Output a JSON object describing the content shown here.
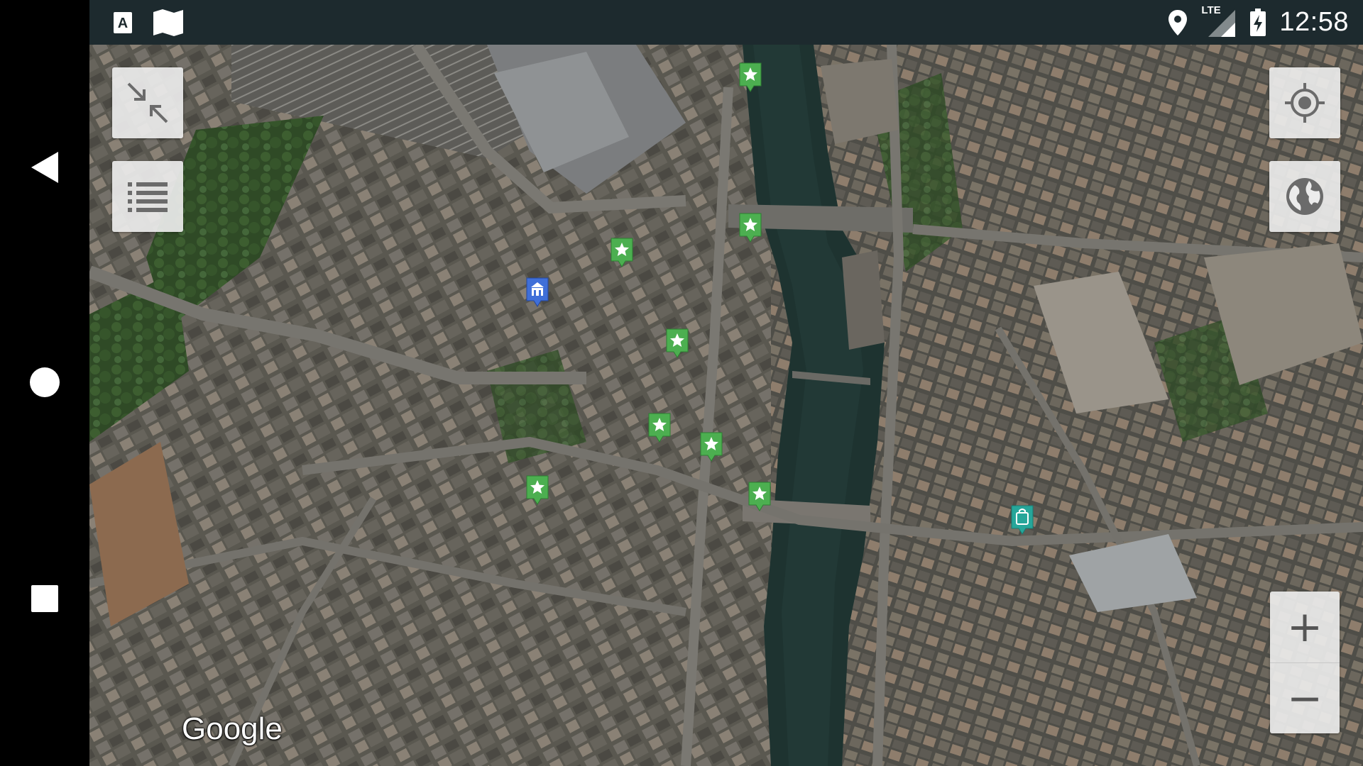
{
  "status_bar": {
    "time": "12:58",
    "network": "LTE",
    "left_icons": [
      "text-a-icon",
      "map-icon"
    ],
    "right_icons": [
      "location-icon",
      "signal-icon",
      "battery-charging-icon"
    ]
  },
  "nav_bar": {
    "buttons": [
      "back-icon",
      "home-icon",
      "recents-icon"
    ]
  },
  "map": {
    "attribution": "Google",
    "type": "satellite",
    "controls": {
      "collapse": "collapse-icon",
      "list": "list-icon",
      "locate": "my-location-icon",
      "layers": "globe-icon",
      "zoom_in": "+",
      "zoom_out": "−"
    },
    "markers": [
      {
        "type": "favorite",
        "color": "#4caf50",
        "icon": "star-icon"
      },
      {
        "type": "favorite",
        "color": "#4caf50",
        "icon": "star-icon"
      },
      {
        "type": "favorite",
        "color": "#4caf50",
        "icon": "star-icon"
      },
      {
        "type": "favorite",
        "color": "#4caf50",
        "icon": "star-icon"
      },
      {
        "type": "favorite",
        "color": "#4caf50",
        "icon": "star-icon"
      },
      {
        "type": "favorite",
        "color": "#4caf50",
        "icon": "star-icon"
      },
      {
        "type": "favorite",
        "color": "#4caf50",
        "icon": "star-icon"
      },
      {
        "type": "favorite",
        "color": "#4caf50",
        "icon": "star-icon"
      },
      {
        "type": "place",
        "color": "#3f6fd8",
        "icon": "building-icon"
      },
      {
        "type": "shop",
        "color": "#26a69a",
        "icon": "shopping-bag-icon"
      }
    ]
  }
}
